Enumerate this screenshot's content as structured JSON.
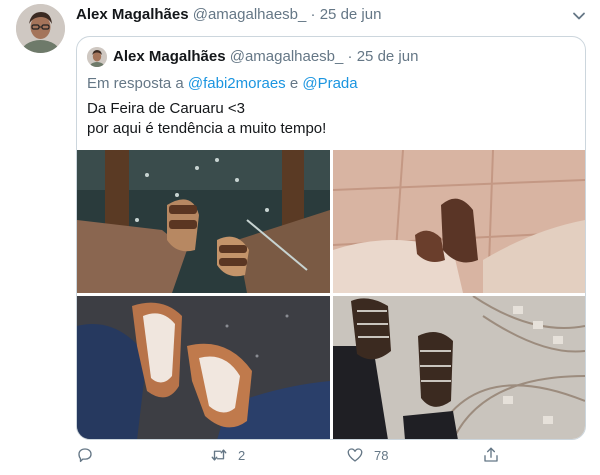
{
  "tweet": {
    "author_name": "Alex Magalhães",
    "author_handle": "@amagalhaesb_",
    "separator": "·",
    "date": "25 de jun"
  },
  "quoted": {
    "author_name": "Alex Magalhães",
    "author_handle": "@amagalhaesb_",
    "separator": "·",
    "date": "25 de jun",
    "reply_prefix": "Em resposta a",
    "reply_user_1": "@fabi2moraes",
    "reply_conjunction": "e",
    "reply_user_2": "@Prada",
    "text_line_1": "Da Feira de Caruaru <3",
    "text_line_2": "por aqui é tendência a muito tempo!"
  },
  "actions": {
    "reply_count": "",
    "retweet_count": "2",
    "like_count": "78"
  },
  "icons": {
    "more": "chevron-down-icon",
    "reply": "reply-icon",
    "retweet": "retweet-icon",
    "like": "heart-icon",
    "share": "share-icon"
  },
  "colors": {
    "text_primary": "#14171a",
    "text_secondary": "#657786",
    "link": "#1b95e0",
    "border": "#ccd6dd"
  }
}
